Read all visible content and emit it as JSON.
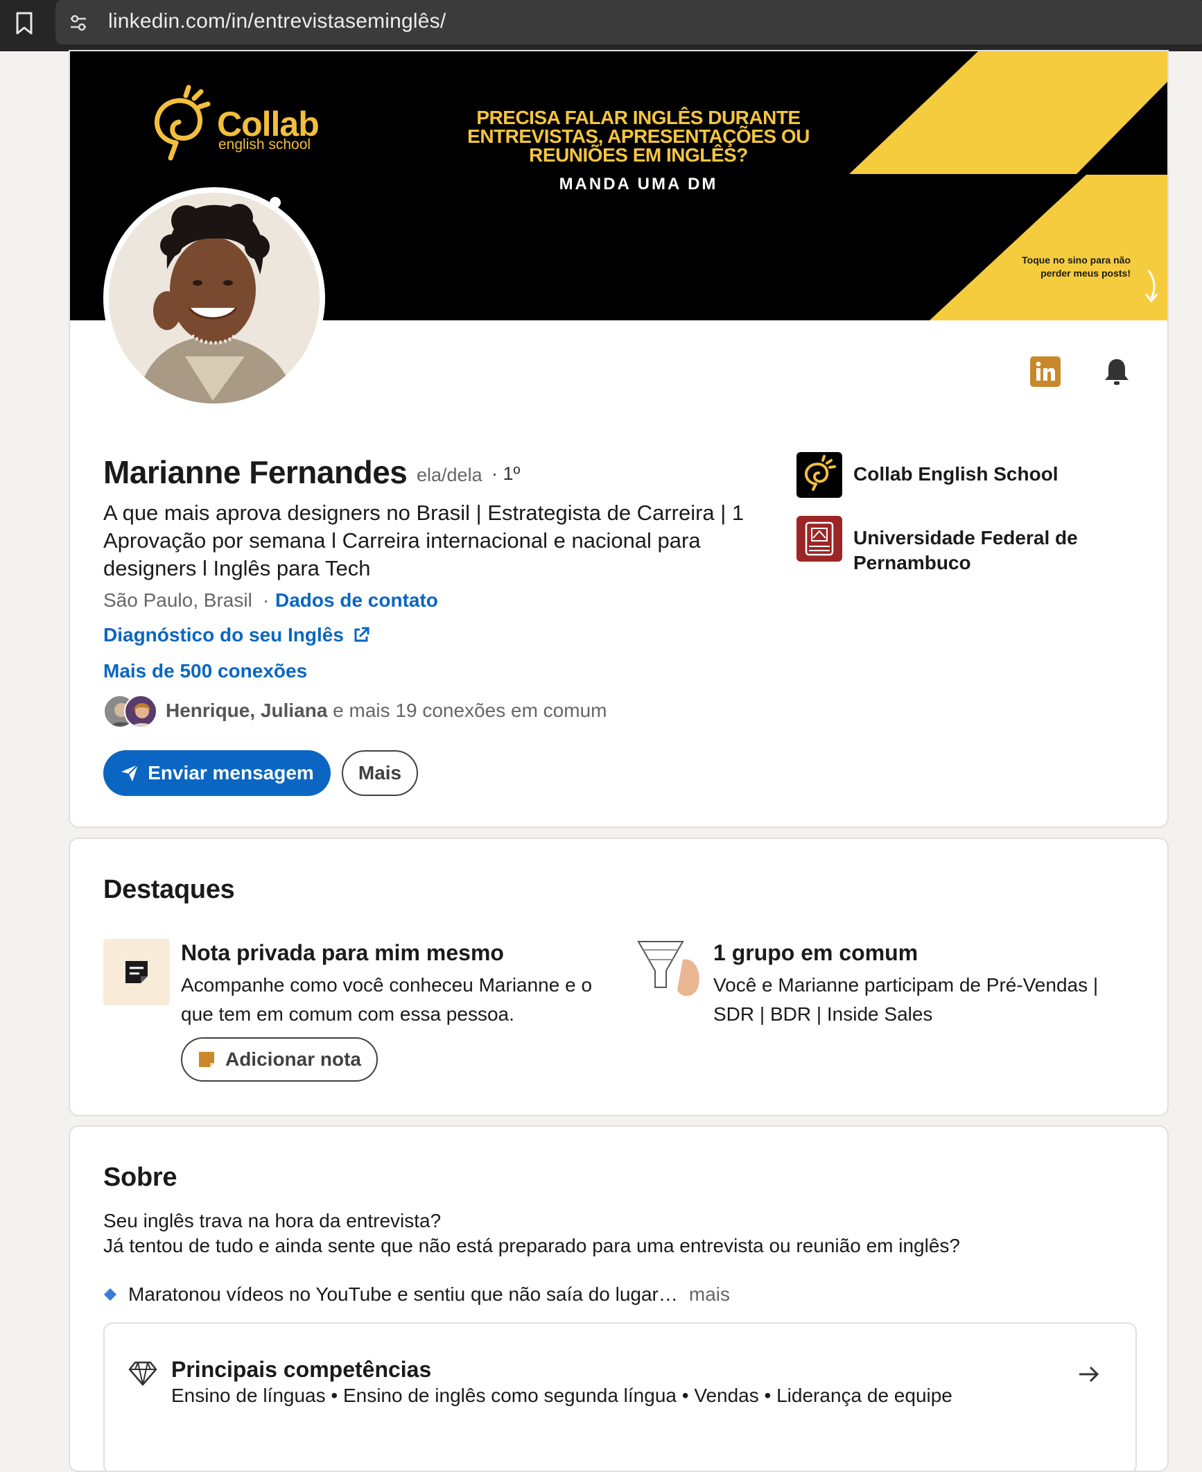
{
  "browser": {
    "url": "linkedin.com/in/entrevistaseminglês/"
  },
  "banner": {
    "brand_name": "Collab",
    "brand_sub": "english school",
    "headline": "PRECISA FALAR INGLÊS DURANTE ENTREVISTAS, APRESENTAÇÕES OU REUNIÕES EM INGLÊS?",
    "cta": "MANDA UMA DM",
    "bell_note": "Toque no sino para não perder meus posts!",
    "accent_color": "#f5c53e"
  },
  "profile": {
    "name": "Marianne Fernandes",
    "pronouns": "ela/dela",
    "degree": "· 1º",
    "headline": "A que mais aprova designers no Brasil | Estrategista de Carreira |  1 Aprovação por semana l Carreira internacional e nacional para designers l Inglês para Tech",
    "location": "São Paulo, Brasil",
    "contact_sep": "·",
    "contact_link": "Dados de contato",
    "website_link": "Diagnóstico do seu Inglês",
    "connections": "Mais de 500 conexões",
    "mutual_names": "Henrique, Juliana",
    "mutual_rest": " e mais 19 conexões em comum",
    "send_message": "Enviar mensagem",
    "more": "Mais",
    "orgs": [
      {
        "name": "Collab English School"
      },
      {
        "name": "Universidade Federal de Pernambuco"
      }
    ],
    "link_color": "#0a66c2"
  },
  "highlights": {
    "title": "Destaques",
    "note_title": "Nota privada para mim mesmo",
    "note_desc": "Acompanhe como você conheceu Marianne e o que tem em comum com essa pessoa.",
    "add_note": "Adicionar nota",
    "group_title": "1 grupo em comum",
    "group_desc": "Você e Marianne participam de Pré-Vendas | SDR | BDR | Inside Sales"
  },
  "about": {
    "title": "Sobre",
    "line1": "Seu inglês trava na hora da entrevista?",
    "line2": "Já tentou de tudo e ainda sente que não está preparado para uma entrevista ou reunião em inglês?",
    "bullet": "Maratonou vídeos no YouTube e sentiu que não saía do lugar…",
    "more": "mais",
    "skills_title": "Principais competências",
    "skills": "Ensino de línguas • Ensino de inglês como segunda língua • Vendas • Liderança de equipe"
  }
}
